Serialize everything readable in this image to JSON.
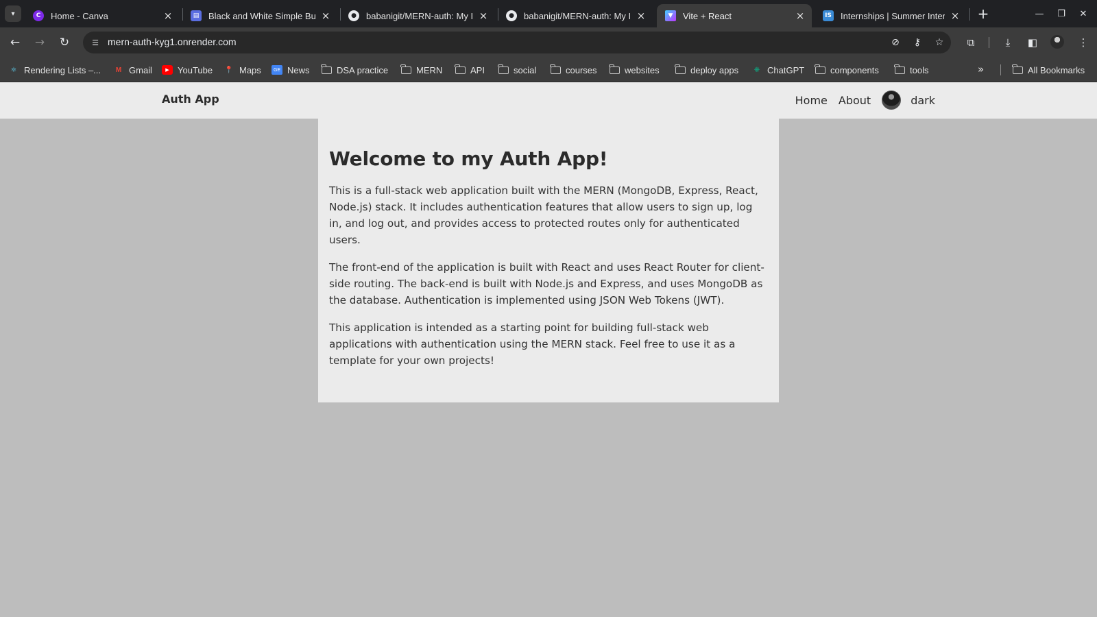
{
  "browser": {
    "tabs": [
      {
        "title": "Home - Canva",
        "favicon": "canva-icon",
        "active": false
      },
      {
        "title": "Black and White Simple Bu",
        "favicon": "document-icon",
        "active": false
      },
      {
        "title": "babanigit/MERN-auth: My I",
        "favicon": "github-icon",
        "active": false
      },
      {
        "title": "babanigit/MERN-auth: My I",
        "favicon": "github-icon",
        "active": false
      },
      {
        "title": "Vite + React",
        "favicon": "vite-icon",
        "active": true
      },
      {
        "title": "Internships | Summer Inter",
        "favicon": "internshala-icon",
        "active": false
      }
    ],
    "url": "mern-auth-kyg1.onrender.com",
    "bookmarks": [
      {
        "label": "Rendering Lists –...",
        "icon": "react-icon"
      },
      {
        "label": "Gmail",
        "icon": "gmail-icon"
      },
      {
        "label": "YouTube",
        "icon": "youtube-icon"
      },
      {
        "label": "Maps",
        "icon": "maps-icon"
      },
      {
        "label": "News",
        "icon": "news-icon"
      },
      {
        "label": "DSA practice",
        "icon": "folder-icon"
      },
      {
        "label": "MERN",
        "icon": "folder-icon"
      },
      {
        "label": "API",
        "icon": "folder-icon"
      },
      {
        "label": "social",
        "icon": "folder-icon"
      },
      {
        "label": "courses",
        "icon": "folder-icon"
      },
      {
        "label": "websites",
        "icon": "folder-icon"
      },
      {
        "label": "deploy apps",
        "icon": "folder-icon"
      },
      {
        "label": "ChatGPT",
        "icon": "chatgpt-icon"
      },
      {
        "label": "components",
        "icon": "folder-icon"
      },
      {
        "label": "tools",
        "icon": "folder-icon"
      }
    ],
    "all_bookmarks": "All Bookmarks"
  },
  "app": {
    "brand": "Auth App",
    "nav": {
      "home": "Home",
      "about": "About",
      "username": "dark"
    },
    "heading": "Welcome to my Auth App!",
    "paragraphs": [
      "This is a full-stack web application built with the MERN (MongoDB, Express, React, Node.js) stack. It includes authentication features that allow users to sign up, log in, and log out, and provides access to protected routes only for authenticated users.",
      "The front-end of the application is built with React and uses React Router for client-side routing. The back-end is built with Node.js and Express, and uses MongoDB as the database. Authentication is implemented using JSON Web Tokens (JWT).",
      "This application is intended as a starting point for building full-stack web applications with authentication using the MERN stack. Feel free to use it as a template for your own projects!"
    ]
  },
  "colors": {
    "page_background": "#bdbdbd",
    "card_background": "#ebebeb",
    "browser_frame": "#202124",
    "toolbar": "#3c3c3c"
  }
}
